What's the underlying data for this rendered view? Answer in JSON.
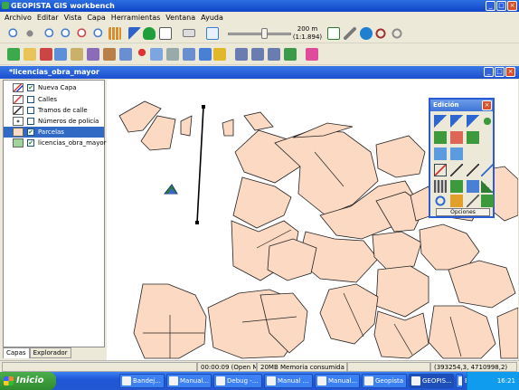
{
  "window": {
    "title": "GEOPISTA GIS workbench",
    "buttons": [
      "_",
      "□",
      "×"
    ]
  },
  "menu": [
    "Archivo",
    "Editar",
    "Vista",
    "Capa",
    "Herramientas",
    "Ventana",
    "Ayuda"
  ],
  "zoom": {
    "distance": "200 m",
    "scale": "(1:1.894)",
    "slider_level": 0.55
  },
  "document": {
    "title": "*licencias_obra_mayor"
  },
  "layers": [
    {
      "label": "Nueva Capa",
      "checked": true,
      "swatch": "lines-red-blue",
      "selected": false
    },
    {
      "label": "Calles",
      "checked": false,
      "swatch": "lines-pink",
      "selected": false
    },
    {
      "label": "Tramos de calle",
      "checked": false,
      "swatch": "lines-black",
      "selected": false
    },
    {
      "label": "Números de policía",
      "checked": false,
      "swatch": "points",
      "selected": false
    },
    {
      "label": "Parcelas",
      "checked": true,
      "swatch": "polygon-pink",
      "selected": true
    },
    {
      "label": "licencias_obra_mayor",
      "checked": true,
      "swatch": "polygon-green",
      "selected": false
    }
  ],
  "panel_tabs": [
    "Capas",
    "Explorador"
  ],
  "palette": {
    "title": "Edición",
    "button_label": "Opciones"
  },
  "status": {
    "time": "00:00:09 (Open Map)",
    "memory": "20MB Memoria consumida",
    "coords": "(393254,3, 4710998,2)"
  },
  "taskbar": {
    "start_label": "Inicio",
    "tasks": [
      "Bandej...",
      "Manual...",
      "Debug -...",
      "Manual ...",
      "Manual...",
      "Geopista",
      "GEOPIS...",
      "Manual..."
    ],
    "lang": "ES",
    "clock": "16:21"
  },
  "colors": {
    "parcel_fill": "#fbd9c3",
    "parcel_stroke": "#222222",
    "title_blue": "#1b4fcf",
    "selection": "#316ac5"
  }
}
